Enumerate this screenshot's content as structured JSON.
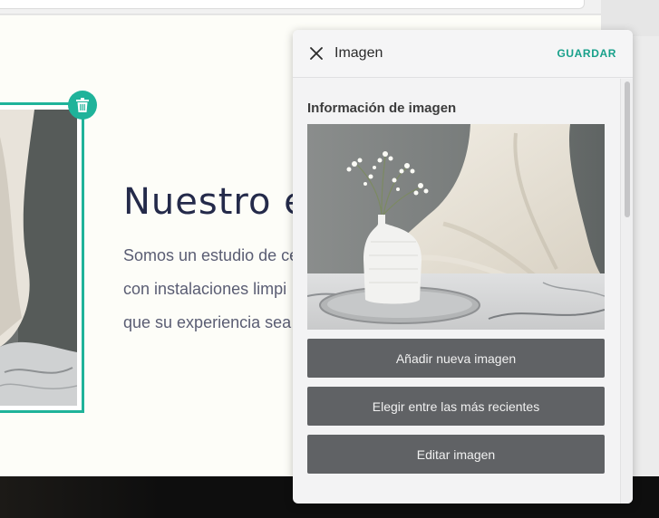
{
  "canvas": {
    "hero_title": "Nuestro e",
    "hero_lines": [
      "Somos un estudio de ce",
      "con instalaciones limpi",
      "que su experiencia sea"
    ]
  },
  "panel": {
    "title": "Imagen",
    "save_label": "GUARDAR",
    "section_label": "Información de imagen",
    "buttons": {
      "add_new": "Añadir nueva imagen",
      "choose_recent": "Elegir entre las más recientes",
      "edit": "Editar imagen"
    }
  },
  "icons": {
    "close": "close-icon",
    "trash": "trash-icon"
  },
  "colors": {
    "accent": "#1fb39a",
    "save_text": "#17a08a",
    "button_bg": "#606265",
    "hero_title": "#242a4a"
  }
}
